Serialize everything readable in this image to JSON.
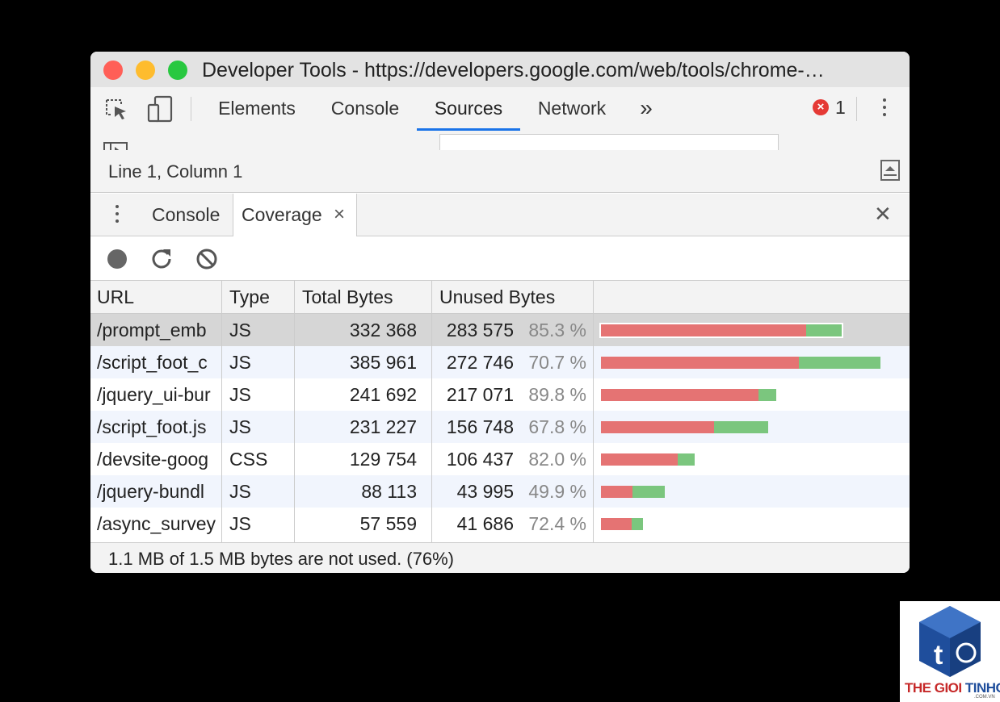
{
  "window": {
    "title": "Developer Tools - https://developers.google.com/web/tools/chrome-…"
  },
  "main_tabs": [
    "Elements",
    "Console",
    "Sources",
    "Network"
  ],
  "active_main_tab": "Sources",
  "overflow_label": "»",
  "error_count": "1",
  "error_badge_symbol": "×",
  "subbar": {
    "overflow_label": "»"
  },
  "status": {
    "position": "Line 1, Column 1"
  },
  "drawer": {
    "tabs": [
      "Console",
      "Coverage"
    ],
    "active_tab": "Coverage",
    "tab_close_symbol": "×",
    "drawer_close_symbol": "✕"
  },
  "coverage": {
    "columns": [
      "URL",
      "Type",
      "Total Bytes",
      "Unused Bytes"
    ],
    "rows": [
      {
        "url": "/prompt_emb",
        "type": "JS",
        "total": "332 368",
        "unused": "283 575",
        "pct": "85.3 %",
        "total_num": 332368,
        "unused_num": 283575
      },
      {
        "url": "/script_foot_c",
        "type": "JS",
        "total": "385 961",
        "unused": "272 746",
        "pct": "70.7 %",
        "total_num": 385961,
        "unused_num": 272746
      },
      {
        "url": "/jquery_ui-bur",
        "type": "JS",
        "total": "241 692",
        "unused": "217 071",
        "pct": "89.8 %",
        "total_num": 241692,
        "unused_num": 217071
      },
      {
        "url": "/script_foot.js",
        "type": "JS",
        "total": "231 227",
        "unused": "156 748",
        "pct": "67.8 %",
        "total_num": 231227,
        "unused_num": 156748
      },
      {
        "url": "/devsite-goog",
        "type": "CSS",
        "total": "129 754",
        "unused": "106 437",
        "pct": "82.0 %",
        "total_num": 129754,
        "unused_num": 106437
      },
      {
        "url": "/jquery-bundl",
        "type": "JS",
        "total": "88 113",
        "unused": "43 995",
        "pct": "49.9 %",
        "total_num": 88113,
        "unused_num": 43995
      },
      {
        "url": "/async_survey",
        "type": "JS",
        "total": "57 559",
        "unused": "41 686",
        "pct": "72.4 %",
        "total_num": 57559,
        "unused_num": 41686
      }
    ],
    "selected_row": 0,
    "colors": {
      "unused": "#e57373",
      "used": "#7bc67e"
    }
  },
  "footer": {
    "summary": "1.1 MB of 1.5 MB bytes are not used. (76%)"
  },
  "logo": {
    "text_red": "THE GIOI ",
    "text_blue": "TINHOC",
    "sub": ".COM.VN",
    "letter": "t"
  }
}
